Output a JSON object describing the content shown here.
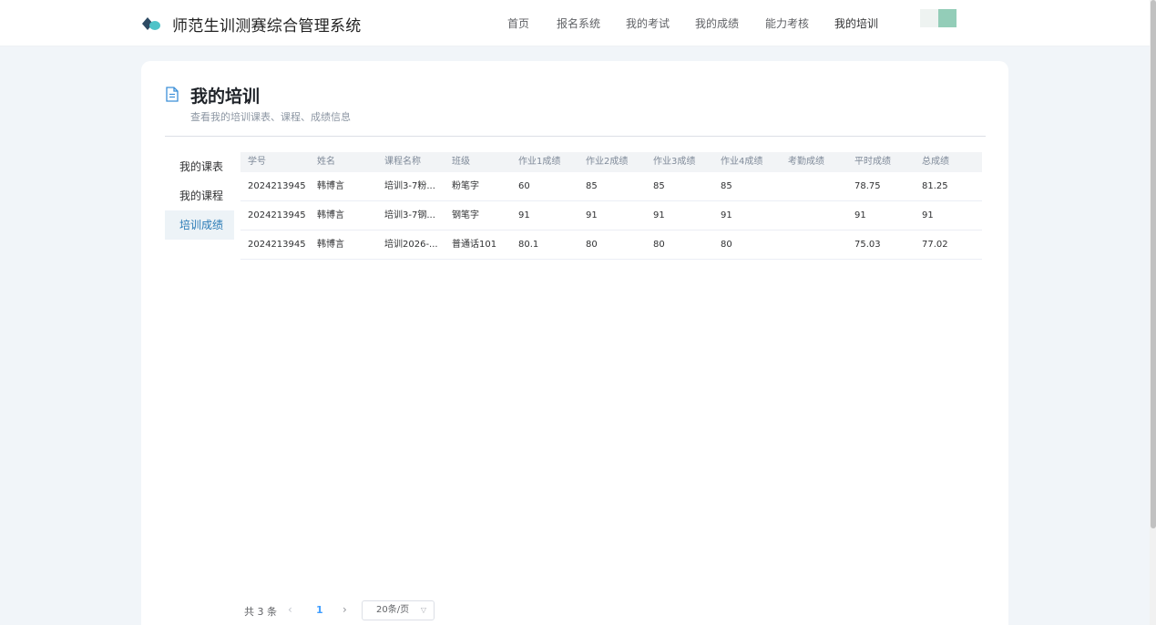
{
  "app": {
    "title": "师范生训测赛综合管理系统"
  },
  "nav": {
    "items": [
      {
        "label": "首页"
      },
      {
        "label": "报名系统"
      },
      {
        "label": "我的考试"
      },
      {
        "label": "我的成绩"
      },
      {
        "label": "能力考核"
      },
      {
        "label": "我的培训"
      }
    ],
    "active": "我的培训"
  },
  "page": {
    "title": "我的培训",
    "subtitle": "查看我的培训课表、课程、成绩信息",
    "icon": "document-icon"
  },
  "side_menu": {
    "items": [
      {
        "label": "我的课表"
      },
      {
        "label": "我的课程"
      },
      {
        "label": "培训成绩"
      }
    ],
    "active": "培训成绩"
  },
  "table": {
    "columns": [
      "学号",
      "姓名",
      "课程名称",
      "班级",
      "作业1成绩",
      "作业2成绩",
      "作业3成绩",
      "作业4成绩",
      "考勤成绩",
      "平时成绩",
      "总成绩"
    ],
    "rows": [
      [
        "2024213945",
        "韩博言",
        "培训3-7粉...",
        "粉笔字",
        "60",
        "85",
        "85",
        "85",
        "",
        "78.75",
        "81.25"
      ],
      [
        "2024213945",
        "韩博言",
        "培训3-7钢...",
        "钢笔字",
        "91",
        "91",
        "91",
        "91",
        "",
        "91",
        "91"
      ],
      [
        "2024213945",
        "韩博言",
        "培训2026-...",
        "普通话101",
        "80.1",
        "80",
        "80",
        "80",
        "",
        "75.03",
        "77.02"
      ]
    ]
  },
  "pagination": {
    "total": "共 3 条",
    "prev": "‹",
    "current_page": "1",
    "next": "›",
    "page_size": "20条/页"
  },
  "colors": {
    "accent": "#409eff",
    "active_menu_text": "#2a7bb6",
    "logo_dark": "#2d4a63",
    "logo_teal": "#4fc3c8"
  }
}
